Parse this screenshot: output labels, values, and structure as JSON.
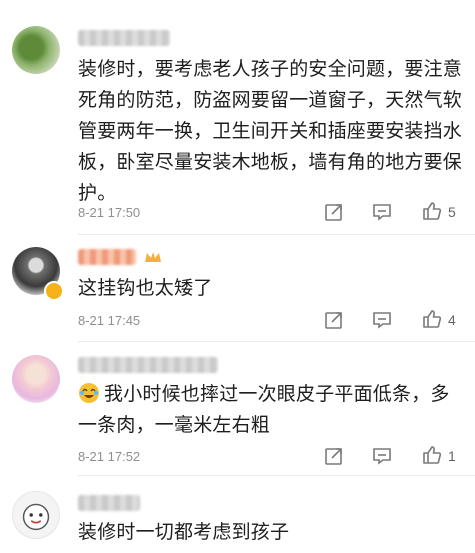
{
  "comments": [
    {
      "text": "装修时，要考虑老人孩子的安全问题，要注意死角的防范，防盗网要留一道窗子，天然气软管要两年一换，卫生间开关和插座要安装挡水板，卧室尽量安装木地板，墙有角的地方要保护。",
      "time": "8-21 17:50",
      "likes": "5"
    },
    {
      "text": "这挂钩也太矮了",
      "time": "8-21 17:45",
      "likes": "4"
    },
    {
      "text": "我小时候也摔过一次眼皮子平面低条，多一条肉，一毫米左右粗",
      "time": "8-21 17:52",
      "likes": "1",
      "emoji": "crying-laughing-emoji"
    },
    {
      "text": "装修时一切都考虑到孩子"
    }
  ],
  "icons": {
    "share": "share-icon",
    "reply": "comment-icon",
    "like": "thumbs-up-icon"
  },
  "colors": {
    "text": "#1e1e1e",
    "meta": "#8f8f8f",
    "icon": "#7a7a7a",
    "badge": "#f5b21a",
    "divider": "#ececec"
  }
}
